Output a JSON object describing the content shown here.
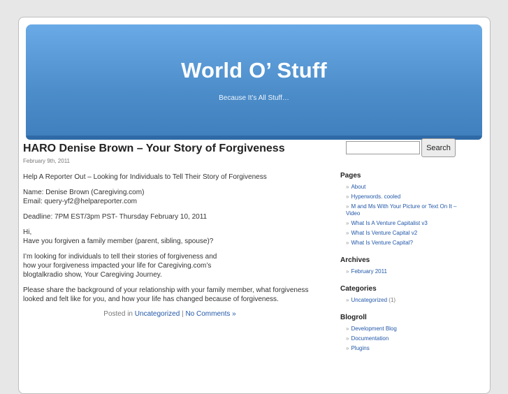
{
  "header": {
    "title": "World O’ Stuff",
    "description": "Because It’s All Stuff…"
  },
  "post": {
    "title": "HARO Denise Brown – Your Story of Forgiveness",
    "date": "February 9th, 2011",
    "p1": "Help A Reporter Out – Looking for Individuals to Tell Their Story of Forgiveness",
    "p2_line1": "Name: Denise Brown (Caregiving.com)",
    "p2_line2": "Email: query-yf2@helpareporter.com",
    "p3": "Deadline: 7PM EST/3pm PST- Thursday February 10, 2011",
    "p4_line1": "Hi,",
    "p4_line2": "Have you forgiven a family member (parent, sibling, spouse)?",
    "p5_line1": "I’m looking for individuals to tell their stories of forgiveness and",
    "p5_line2": "how your forgiveness impacted your life for Caregiving.com’s",
    "p5_line3": "blogtalkradio show, Your Caregiving Journey.",
    "p6_line1": "Please share the background of your relationship with your family member, what forgiveness",
    "p6_line2": "looked and felt like for you, and how your life has changed because of forgiveness.",
    "meta_prefix": "Posted in",
    "category_link": "Uncategorized",
    "separator": "|",
    "comments_link": "No Comments »"
  },
  "sidebar": {
    "search_value": "",
    "search_button": "Search",
    "bullet": "»",
    "pages_title": "Pages",
    "pages": [
      "About",
      "Hyperwords. cooled",
      "M and Ms With Your Picture or Text On It – Video",
      "What Is A Venture Capitalist v3",
      "What Is Venture Capital v2",
      "What Is Venture Capital?"
    ],
    "archives_title": "Archives",
    "archives": [
      "February 2011"
    ],
    "categories_title": "Categories",
    "categories": [
      {
        "label": "Uncategorized",
        "count": "(1)"
      }
    ],
    "blogroll_title": "Blogroll",
    "blogroll": [
      "Development Blog",
      "Documentation",
      "Plugins"
    ]
  }
}
